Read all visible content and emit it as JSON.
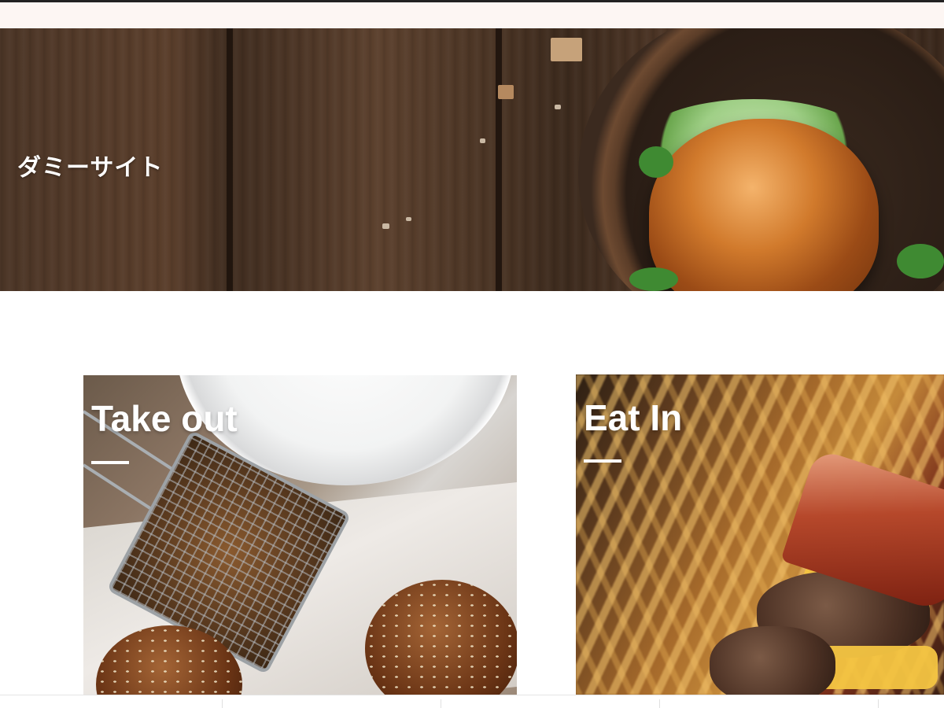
{
  "site": {
    "title": "ダミーサイト"
  },
  "cards": [
    {
      "title": "Take out"
    },
    {
      "title": "Eat In"
    }
  ],
  "icons": {
    "card_underline": "underline-decoration"
  },
  "colors": {
    "page_bg": "#ffffff",
    "top_strip": "#fdf6f3",
    "title_text": "#ffffff"
  }
}
